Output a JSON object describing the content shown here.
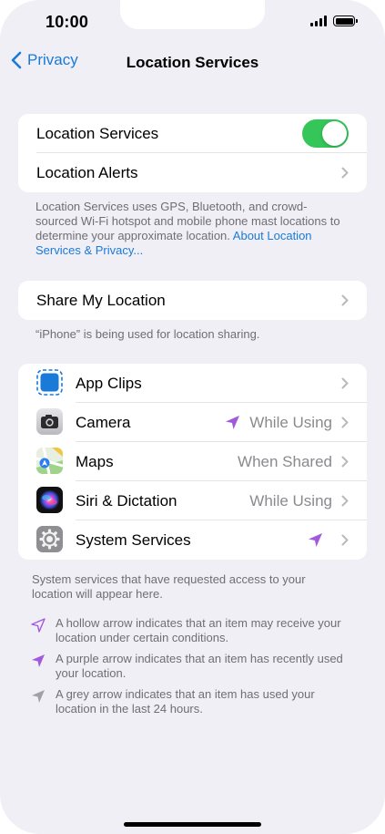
{
  "status_bar": {
    "time": "10:00"
  },
  "nav": {
    "back_label": "Privacy",
    "title": "Location Services"
  },
  "section1": {
    "location_services_label": "Location Services",
    "location_services_on": true,
    "location_alerts_label": "Location Alerts",
    "footer_text": "Location Services uses GPS, Bluetooth, and crowd-sourced Wi-Fi hotspot and mobile phone mast locations to determine your approximate location.",
    "footer_link": "About Location Services & Privacy..."
  },
  "section2": {
    "share_label": "Share My Location",
    "footer_text": "“iPhone” is being used for location sharing."
  },
  "apps": [
    {
      "name": "App Clips",
      "value": "",
      "arrow": "",
      "icon": "app-clips-icon"
    },
    {
      "name": "Camera",
      "value": "While Using",
      "arrow": "purple",
      "icon": "camera-icon"
    },
    {
      "name": "Maps",
      "value": "When Shared",
      "arrow": "",
      "icon": "maps-icon"
    },
    {
      "name": "Siri & Dictation",
      "value": "While Using",
      "arrow": "",
      "icon": "siri-icon"
    },
    {
      "name": "System Services",
      "value": "",
      "arrow": "purple",
      "icon": "system-services-icon"
    }
  ],
  "apps_footer": "System services that have requested access to your location will appear here.",
  "legend": [
    {
      "type": "hollow",
      "text": "A hollow arrow indicates that an item may receive your location under certain conditions."
    },
    {
      "type": "purple",
      "text": "A purple arrow indicates that an item has recently used your location."
    },
    {
      "type": "grey",
      "text": "A grey arrow indicates that an item has used your location in the last 24 hours."
    }
  ],
  "colors": {
    "accent": "#1a7ad8",
    "toggle_on": "#34c659",
    "arrow_purple": "#a259dc",
    "arrow_grey": "#a0a0a5",
    "background": "#f0eff5"
  }
}
